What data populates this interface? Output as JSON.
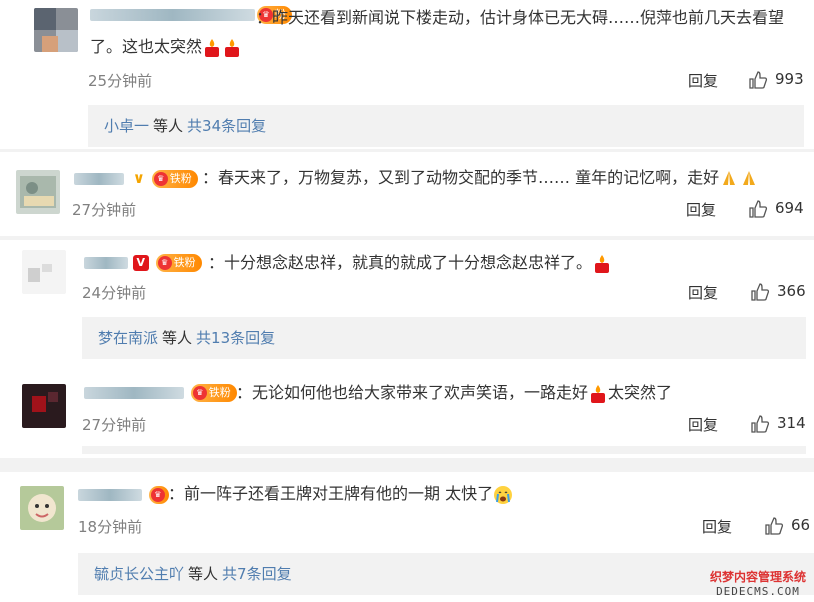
{
  "comments": [
    {
      "text_line1": "：昨天还看到新闻说下楼走动，估计身体已无大碍……倪萍也前几天去看望",
      "text_line2": "了。这也太突然",
      "time": "25分钟前",
      "reply": "回复",
      "likes": "993",
      "sub": {
        "who": "小卓一",
        "mid": "等人",
        "count": "共34条回复"
      }
    },
    {
      "text_line1": "：春天来了，万物复苏，又到了动物交配的季节…… 童年的记忆啊，走好",
      "time": "27分钟前",
      "reply": "回复",
      "likes": "694"
    },
    {
      "text_line1": "：十分想念赵忠祥，就真的就成了十分想念赵忠祥了。",
      "time": "24分钟前",
      "reply": "回复",
      "likes": "366",
      "sub": {
        "who": "梦在南派",
        "mid": "等人",
        "count": "共13条回复"
      }
    },
    {
      "text_line1": "：无论如何他也给大家带来了欢声笑语，一路走好",
      "text_line1b": "太突然了",
      "time": "27分钟前",
      "reply": "回复",
      "likes": "314"
    },
    {
      "text_line1": "：前一阵子还看王牌对王牌有他的一期 太快了",
      "time": "18分钟前",
      "reply": "回复",
      "likes": "66",
      "sub": {
        "who": "毓贞长公主吖",
        "mid": "等人",
        "count": "共7条回复"
      }
    }
  ],
  "badges": {
    "vip": "V",
    "fan": "铁粉",
    "fan_short": "粉"
  },
  "watermark": {
    "line1": "织梦内容管理系统",
    "line2": "DEDECMS.COM"
  },
  "colors": {
    "name": "#eb7350",
    "link": "#507daf",
    "muted": "#808080"
  }
}
